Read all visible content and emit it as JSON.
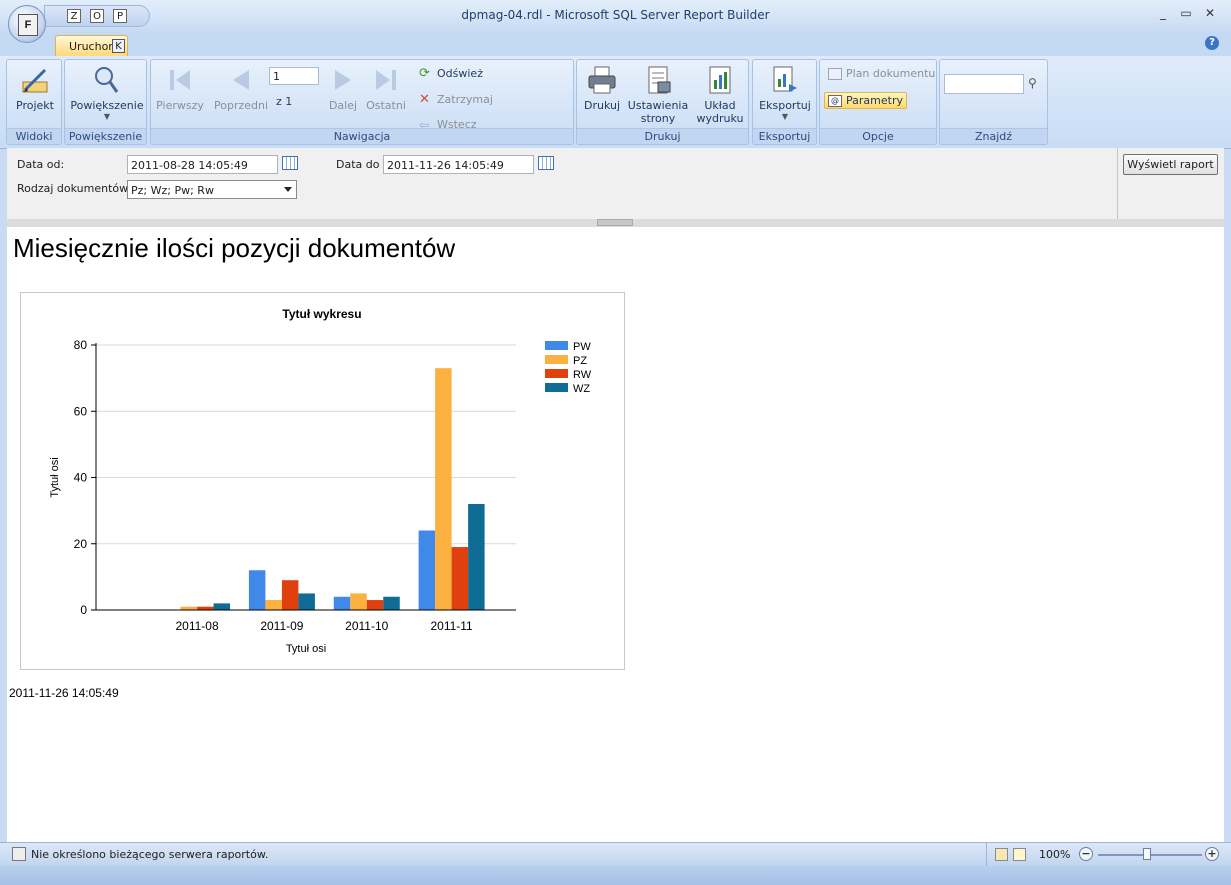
{
  "window": {
    "title": "dpmag-04.rdl - Microsoft SQL Server Report Builder",
    "app_button_letter": "F",
    "qat_keys": [
      "Z",
      "O",
      "P"
    ],
    "controls": [
      "_",
      "▭",
      "✕"
    ]
  },
  "tabs": {
    "run_label": "Uruchom",
    "run_key": "K",
    "help": "?"
  },
  "ribbon": {
    "groups": {
      "widoki": "Widoki",
      "powiekszenie": "Powiększenie",
      "nawigacja": "Nawigacja",
      "drukuj": "Drukuj",
      "eksportuj": "Eksportuj",
      "opcje": "Opcje",
      "znajdz": "Znajdź"
    },
    "projekt": "Projekt",
    "powiekszenie_btn": "Powiększenie",
    "pierwszy": "Pierwszy",
    "poprzedni": "Poprzedni",
    "page_value": "1",
    "page_of": "z  1",
    "dalej": "Dalej",
    "ostatni": "Ostatni",
    "odswiez": "Odśwież",
    "zatrzymaj": "Zatrzymaj",
    "wstecz": "Wstecz",
    "drukuj_btn": "Drukuj",
    "ustawienia_1": "Ustawienia",
    "ustawienia_2": "strony",
    "uklad_1": "Układ",
    "uklad_2": "wydruku",
    "eksportuj_btn": "Eksportuj",
    "plan": "Plan dokumentu",
    "parametry": "Parametry",
    "find_value": ""
  },
  "params": {
    "date_from_label": "Data od:",
    "date_from_value": "2011-08-28 14:05:49",
    "date_to_label": "Data do",
    "date_to_value": "2011-11-26 14:05:49",
    "doc_type_label": "Rodzaj dokumentów",
    "doc_type_value": "Pz; Wz; Pw; Rw",
    "view_report": "Wyświetl raport"
  },
  "report": {
    "title": "Miesięcznie ilości pozycji dokumentów",
    "footer_timestamp": "2011-11-26 14:05:49"
  },
  "chart_data": {
    "type": "bar",
    "title": "Tytuł wykresu",
    "xlabel": "Tytuł osi",
    "ylabel": "Tytuł osi",
    "categories": [
      "2011-08",
      "2011-09",
      "2011-10",
      "2011-11"
    ],
    "ylim": [
      0,
      80
    ],
    "yticks": [
      0,
      20,
      40,
      60,
      80
    ],
    "grid": true,
    "legend_position": "top-right",
    "series": [
      {
        "name": "PW",
        "color": "#4189e8",
        "values": [
          0,
          12,
          4,
          24
        ]
      },
      {
        "name": "PZ",
        "color": "#fbb040",
        "values": [
          1,
          3,
          5,
          73
        ]
      },
      {
        "name": "RW",
        "color": "#e0400e",
        "values": [
          1,
          9,
          3,
          19
        ]
      },
      {
        "name": "WZ",
        "color": "#0f6d95",
        "values": [
          2,
          5,
          4,
          32
        ]
      }
    ]
  },
  "status": {
    "text": "Nie określono bieżącego serwera raportów.",
    "zoom": "100%",
    "zoom_minus": "−",
    "zoom_plus": "+"
  }
}
